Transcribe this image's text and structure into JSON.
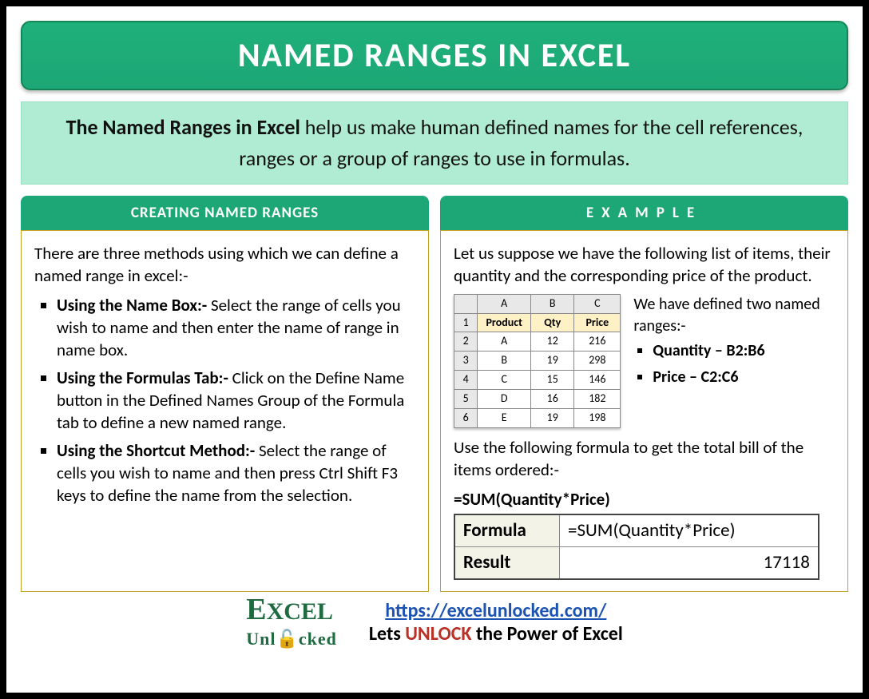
{
  "title": "NAMED RANGES IN EXCEL",
  "intro": {
    "bold": "The Named Ranges in Excel",
    "rest": " help us make human defined names for the cell references, ranges or a group of ranges to use in formulas."
  },
  "left": {
    "header": "CREATING NAMED RANGES",
    "lead": "There are three methods using which we can define a named range in excel:-",
    "methods": [
      {
        "b": "Using the Name Box:-",
        "t": " Select the range of cells you wish to name and then enter the name of range in name box."
      },
      {
        "b": "Using the Formulas Tab:-",
        "t": " Click on the Define Name button in the Defined Names Group of the Formula tab to define a new named range."
      },
      {
        "b": "Using the Shortcut Method:-",
        "t": " Select the range of cells you wish to name and then press Ctrl Shift F3 keys to define the name from the selection."
      }
    ]
  },
  "right": {
    "header": "EXAMPLE",
    "lead": "Let us suppose we have the following list of items, their quantity and the corresponding price of the product.",
    "grid_cols": [
      "A",
      "B",
      "C"
    ],
    "grid_headers": [
      "Product",
      "Qty",
      "Price"
    ],
    "grid_data": [
      [
        "A",
        "12",
        "216"
      ],
      [
        "B",
        "19",
        "298"
      ],
      [
        "C",
        "15",
        "146"
      ],
      [
        "D",
        "16",
        "182"
      ],
      [
        "E",
        "19",
        "198"
      ]
    ],
    "defined_lead": "We have defined two named ranges:-",
    "ranges": [
      "Quantity – B2:B6",
      "Price – C2:C6"
    ],
    "use_lead": "Use the following formula to get the total bill of the items ordered:-",
    "formula_inline": "=SUM(Quantity*Price)",
    "formula_table": {
      "formula_label": "Formula",
      "formula": "=SUM(Quantity*Price)",
      "result_label": "Result",
      "result": "17118"
    }
  },
  "footer": {
    "url": "https://excelunlocked.com/",
    "slogan_pre": "Lets ",
    "slogan_bold": "UNLOCK",
    "slogan_post": " the Power of Excel"
  }
}
